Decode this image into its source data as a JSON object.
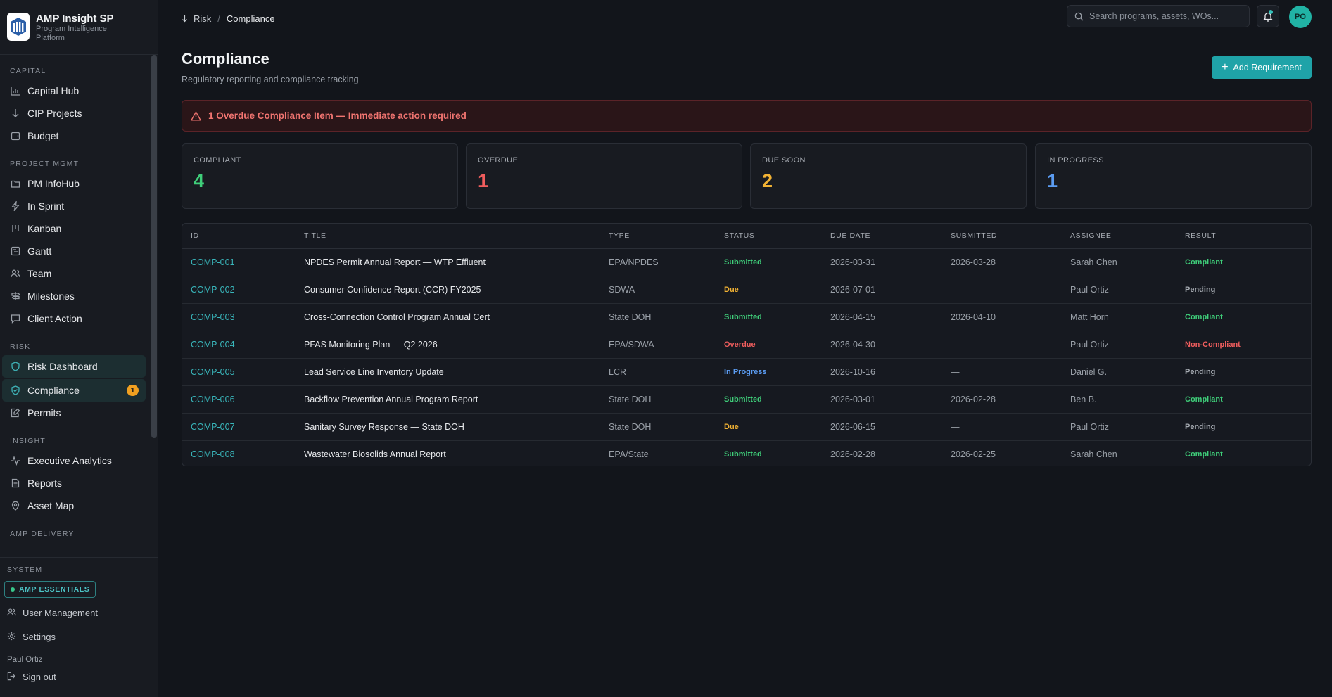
{
  "brand": {
    "title": "AMP Insight SP",
    "subtitle": "Program Intelligence Platform"
  },
  "nav": {
    "sections": [
      {
        "label": "CAPITAL",
        "items": [
          {
            "label": "Capital Hub",
            "icon": "bar-chart-icon"
          },
          {
            "label": "CIP Projects",
            "icon": "arrow-down-icon"
          },
          {
            "label": "Budget",
            "icon": "wallet-icon"
          }
        ]
      },
      {
        "label": "PROJECT MGMT",
        "items": [
          {
            "label": "PM InfoHub",
            "icon": "folder-icon"
          },
          {
            "label": "In Sprint",
            "icon": "lightning-icon"
          },
          {
            "label": "Kanban",
            "icon": "kanban-icon"
          },
          {
            "label": "Gantt",
            "icon": "gantt-icon"
          },
          {
            "label": "Team",
            "icon": "users-icon"
          },
          {
            "label": "Milestones",
            "icon": "signpost-icon"
          },
          {
            "label": "Client Action",
            "icon": "message-icon"
          }
        ]
      },
      {
        "label": "RISK",
        "items": [
          {
            "label": "Risk Dashboard",
            "icon": "shield-icon"
          },
          {
            "label": "Compliance",
            "icon": "shield-check-icon",
            "badge": "1"
          },
          {
            "label": "Permits",
            "icon": "edit-doc-icon"
          }
        ]
      },
      {
        "label": "INSIGHT",
        "items": [
          {
            "label": "Executive Analytics",
            "icon": "activity-icon"
          },
          {
            "label": "Reports",
            "icon": "file-text-icon"
          },
          {
            "label": "Asset Map",
            "icon": "map-pin-icon"
          }
        ]
      },
      {
        "label": "AMP DELIVERY",
        "items": []
      }
    ]
  },
  "system": {
    "label": "SYSTEM",
    "badge": "AMP ESSENTIALS",
    "user_management": "User Management",
    "settings": "Settings",
    "user_name": "Paul Ortiz",
    "sign_out": "Sign out"
  },
  "topbar": {
    "breadcrumb_parent": "Risk",
    "breadcrumb_sep": "/",
    "breadcrumb_current": "Compliance",
    "search_placeholder": "Search programs, assets, WOs...",
    "avatar_initials": "PO"
  },
  "page": {
    "title": "Compliance",
    "subtitle": "Regulatory reporting and compliance tracking",
    "add_button": "Add Requirement",
    "alert": "1 Overdue Compliance Item — Immediate action required"
  },
  "stats": [
    {
      "label": "COMPLIANT",
      "value": "4",
      "color": "#3fcf7a"
    },
    {
      "label": "OVERDUE",
      "value": "1",
      "color": "#ef5d5d"
    },
    {
      "label": "DUE SOON",
      "value": "2",
      "color": "#f2b233"
    },
    {
      "label": "IN PROGRESS",
      "value": "1",
      "color": "#5b9cf2"
    }
  ],
  "table": {
    "columns": [
      "ID",
      "TITLE",
      "TYPE",
      "STATUS",
      "DUE DATE",
      "SUBMITTED",
      "ASSIGNEE",
      "RESULT"
    ],
    "rows": [
      {
        "id": "COMP-001",
        "title": "NPDES Permit Annual Report — WTP Effluent",
        "type": "EPA/NPDES",
        "status": "Submitted",
        "due": "2026-03-31",
        "submitted": "2026-03-28",
        "assignee": "Sarah Chen",
        "result": "Compliant"
      },
      {
        "id": "COMP-002",
        "title": "Consumer Confidence Report (CCR) FY2025",
        "type": "SDWA",
        "status": "Due",
        "due": "2026-07-01",
        "submitted": "—",
        "assignee": "Paul Ortiz",
        "result": "Pending"
      },
      {
        "id": "COMP-003",
        "title": "Cross-Connection Control Program Annual Cert",
        "type": "State DOH",
        "status": "Submitted",
        "due": "2026-04-15",
        "submitted": "2026-04-10",
        "assignee": "Matt Horn",
        "result": "Compliant"
      },
      {
        "id": "COMP-004",
        "title": "PFAS Monitoring Plan — Q2 2026",
        "type": "EPA/SDWA",
        "status": "Overdue",
        "due": "2026-04-30",
        "submitted": "—",
        "assignee": "Paul Ortiz",
        "result": "Non-Compliant"
      },
      {
        "id": "COMP-005",
        "title": "Lead Service Line Inventory Update",
        "type": "LCR",
        "status": "In Progress",
        "due": "2026-10-16",
        "submitted": "—",
        "assignee": "Daniel G.",
        "result": "Pending"
      },
      {
        "id": "COMP-006",
        "title": "Backflow Prevention Annual Program Report",
        "type": "State DOH",
        "status": "Submitted",
        "due": "2026-03-01",
        "submitted": "2026-02-28",
        "assignee": "Ben B.",
        "result": "Compliant"
      },
      {
        "id": "COMP-007",
        "title": "Sanitary Survey Response — State DOH",
        "type": "State DOH",
        "status": "Due",
        "due": "2026-06-15",
        "submitted": "—",
        "assignee": "Paul Ortiz",
        "result": "Pending"
      },
      {
        "id": "COMP-008",
        "title": "Wastewater Biosolids Annual Report",
        "type": "EPA/State",
        "status": "Submitted",
        "due": "2026-02-28",
        "submitted": "2026-02-25",
        "assignee": "Sarah Chen",
        "result": "Compliant"
      }
    ]
  },
  "colors": {
    "Submitted": "#3fcf7a",
    "Due": "#f2b233",
    "Overdue": "#ef5d5d",
    "In Progress": "#5b9cf2",
    "Compliant": "#3fcf7a",
    "Pending": "#a6abb2",
    "Non-Compliant": "#ef5d5d",
    "accent": "#1fa3a8"
  }
}
